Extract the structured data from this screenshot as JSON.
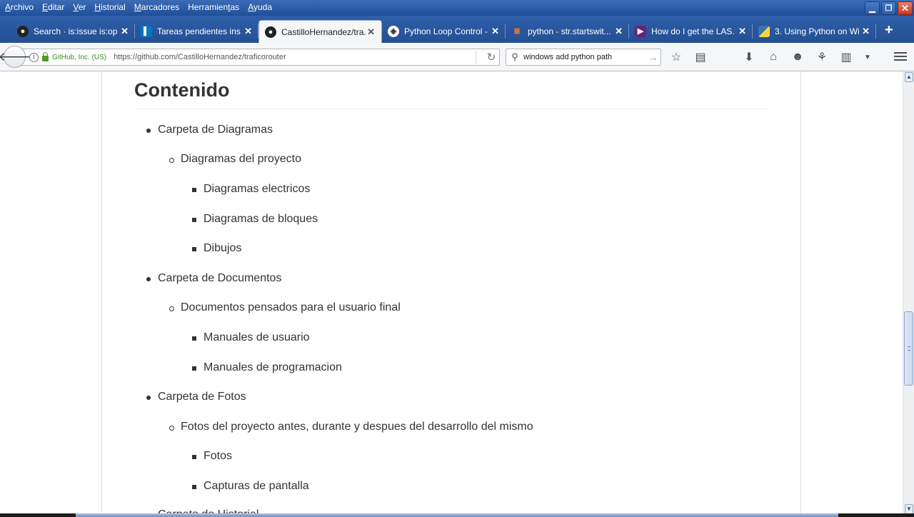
{
  "menubar": {
    "items": [
      {
        "pre": "",
        "u": "A",
        "post": "rchivo"
      },
      {
        "pre": "",
        "u": "E",
        "post": "ditar"
      },
      {
        "pre": "",
        "u": "V",
        "post": "er"
      },
      {
        "pre": "",
        "u": "H",
        "post": "istorial"
      },
      {
        "pre": "",
        "u": "M",
        "post": "arcadores"
      },
      {
        "pre": "Herramien",
        "u": "t",
        "post": "as"
      },
      {
        "pre": "",
        "u": "A",
        "post": "yuda"
      }
    ]
  },
  "tabs": [
    {
      "label": "Search · is:issue is:op...",
      "icon": "github-icon"
    },
    {
      "label": "Tareas pendientes ins...",
      "icon": "trello-icon"
    },
    {
      "label": "CastilloHernandez/tra...",
      "icon": "github-icon"
    },
    {
      "label": "Python Loop Control -...",
      "icon": "tutorialspoint-icon"
    },
    {
      "label": "python - str.startswit...",
      "icon": "stackoverflow-icon"
    },
    {
      "label": "How do I get the LAS...",
      "icon": "visualstudio-icon"
    },
    {
      "label": "3. Using Python on Wi...",
      "icon": "python-icon"
    }
  ],
  "navbar": {
    "identity": "GitHub, Inc. (US)",
    "url": "https://github.com/CastilloHernandez/traficorouter",
    "search_value": "windows add python path"
  },
  "content": {
    "heading": "Contenido",
    "list": [
      {
        "level": 1,
        "text": "Carpeta de Diagramas"
      },
      {
        "level": 2,
        "text": "Diagramas del proyecto"
      },
      {
        "level": 3,
        "text": "Diagramas electricos"
      },
      {
        "level": 3,
        "text": "Diagramas de bloques"
      },
      {
        "level": 3,
        "text": "Dibujos"
      },
      {
        "level": 1,
        "text": "Carpeta de Documentos"
      },
      {
        "level": 2,
        "text": "Documentos pensados para el usuario final"
      },
      {
        "level": 3,
        "text": "Manuales de usuario"
      },
      {
        "level": 3,
        "text": "Manuales de programacion"
      },
      {
        "level": 1,
        "text": "Carpeta de Fotos"
      },
      {
        "level": 2,
        "text": "Fotos del proyecto antes, durante y despues del desarrollo del mismo"
      },
      {
        "level": 3,
        "text": "Fotos"
      },
      {
        "level": 3,
        "text": "Capturas de pantalla"
      },
      {
        "level": 1,
        "text": "Carpeta de Historial"
      }
    ]
  },
  "colors": {
    "chrome_blue": "#2a5aa6",
    "text": "#333333",
    "secure_green": "#3e8a1f"
  }
}
